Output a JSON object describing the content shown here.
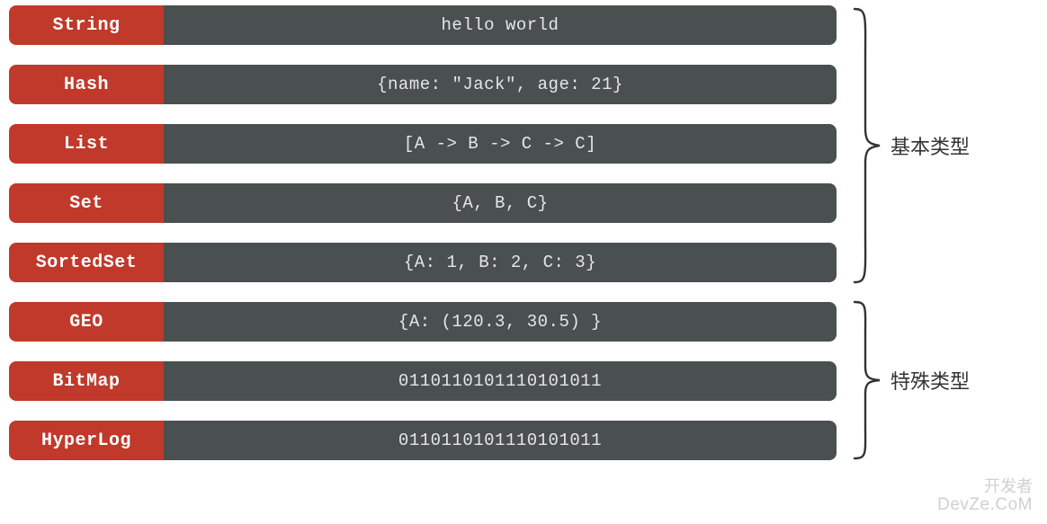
{
  "rows": [
    {
      "label": "String",
      "value": "hello world"
    },
    {
      "label": "Hash",
      "value": "{name: \"Jack\", age: 21}"
    },
    {
      "label": "List",
      "value": "[A -> B -> C -> C]"
    },
    {
      "label": "Set",
      "value": "{A, B, C}"
    },
    {
      "label": "SortedSet",
      "value": "{A: 1, B: 2, C: 3}"
    },
    {
      "label": "GEO",
      "value": "{A: (120.3,  30.5) }"
    },
    {
      "label": "BitMap",
      "value": "0110110101110101011"
    },
    {
      "label": "HyperLog",
      "value": "0110110101110101011"
    }
  ],
  "categories": {
    "basic": "基本类型",
    "special": "特殊类型"
  },
  "colors": {
    "label_bg": "#c0392b",
    "value_bg": "#4a4f50",
    "text": "#e6e6e6"
  },
  "watermark": {
    "line1": "开发者",
    "line2": "DevZe.CoM"
  }
}
